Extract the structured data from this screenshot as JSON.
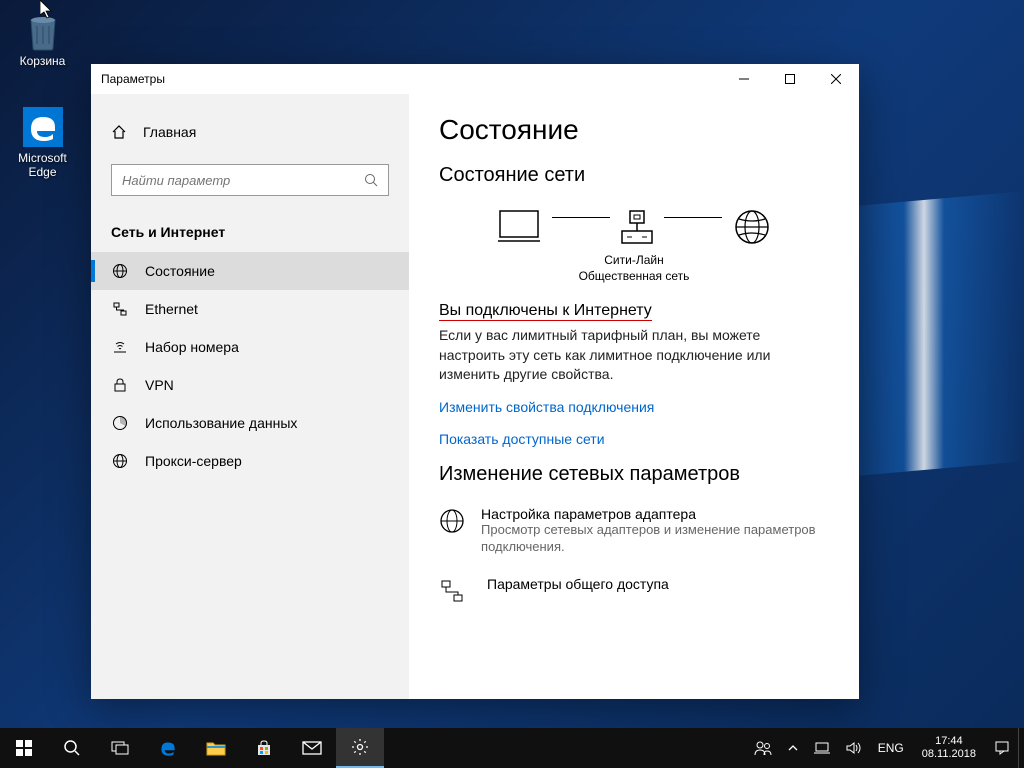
{
  "desktop": {
    "icons": [
      {
        "label": "Корзина"
      },
      {
        "label": "Microsoft Edge"
      }
    ]
  },
  "window": {
    "title": "Параметры"
  },
  "sidebar": {
    "home_label": "Главная",
    "search_placeholder": "Найти параметр",
    "section_title": "Сеть и Интернет",
    "items": [
      {
        "label": "Состояние"
      },
      {
        "label": "Ethernet"
      },
      {
        "label": "Набор номера"
      },
      {
        "label": "VPN"
      },
      {
        "label": "Использование данных"
      },
      {
        "label": "Прокси-сервер"
      }
    ]
  },
  "content": {
    "page_title": "Состояние",
    "net_status_title": "Состояние сети",
    "diagram_net_name": "Сити-Лайн",
    "diagram_net_type": "Общественная сеть",
    "connected_heading": "Вы подключены к Интернету",
    "connected_body": "Если у вас лимитный тарифный план, вы можете настроить эту сеть как лимитное подключение или изменить другие свойства.",
    "link_change_props": "Изменить свойства подключения",
    "link_show_nets": "Показать доступные сети",
    "change_net_title": "Изменение сетевых параметров",
    "rows": [
      {
        "title": "Настройка параметров адаптера",
        "desc": "Просмотр сетевых адаптеров и изменение параметров подключения."
      },
      {
        "title": "Параметры общего доступа",
        "desc": ""
      }
    ]
  },
  "taskbar": {
    "lang": "ENG",
    "time": "17:44",
    "date": "08.11.2018"
  }
}
